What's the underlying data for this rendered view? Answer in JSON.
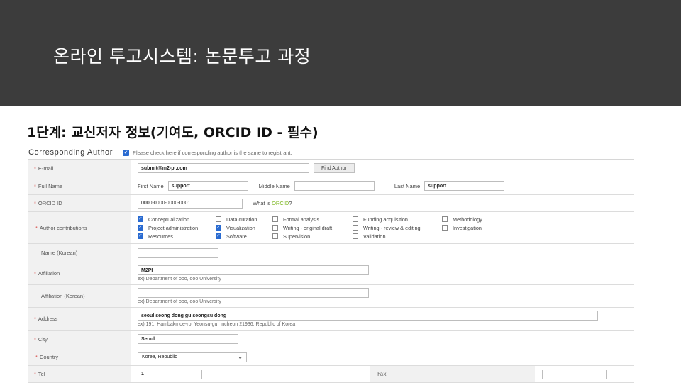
{
  "slide": {
    "title": "온라인 투고시스템: 논문투고 과정"
  },
  "step": {
    "title": "1단계: 교신저자 정보(기여도, ORCID ID - 필수)"
  },
  "corresponding": {
    "label": "Corresponding Author",
    "checked": true,
    "note": "Please check here if corresponding author is the same to registrant."
  },
  "form": {
    "email": {
      "label": "E-mail",
      "value": "submit@m2-pi.com",
      "button": "Find Author"
    },
    "full_name": {
      "label": "Full Name",
      "first_label": "First Name",
      "first_value": "support",
      "middle_label": "Middle Name",
      "middle_value": "",
      "last_label": "Last Name",
      "last_value": "support"
    },
    "orcid": {
      "label": "ORCID ID",
      "value": "0000-0000-0000-0001",
      "what_is": "What is ",
      "link": "ORCID",
      "q": "?"
    },
    "contributions": {
      "label": "Author contributions",
      "items": [
        {
          "text": "Conceptualization",
          "checked": true
        },
        {
          "text": "Data curation",
          "checked": false
        },
        {
          "text": "Formal analysis",
          "checked": false
        },
        {
          "text": "Funding acquisition",
          "checked": false
        },
        {
          "text": "Methodology",
          "checked": false
        },
        {
          "text": "Project administration",
          "checked": true
        },
        {
          "text": "Visualization",
          "checked": true
        },
        {
          "text": "Writing - original draft",
          "checked": false
        },
        {
          "text": "Writing - review & editing",
          "checked": false
        },
        {
          "text": "Investigation",
          "checked": false
        },
        {
          "text": "Resources",
          "checked": true
        },
        {
          "text": "Software",
          "checked": true
        },
        {
          "text": "Supervision",
          "checked": false
        },
        {
          "text": "Validation",
          "checked": false
        }
      ]
    },
    "name_korean": {
      "label": "Name (Korean)",
      "value": ""
    },
    "affiliation": {
      "label": "Affiliation",
      "value": "M2PI",
      "hint": "ex) Department of ooo, ooo University"
    },
    "affiliation_korean": {
      "label": "Affiliation (Korean)",
      "value": "",
      "hint": "ex) Department of ooo, ooo University"
    },
    "address": {
      "label": "Address",
      "value": "seoul seong dong gu seongsu dong",
      "hint": "ex) 191, Hambakmoe-ro, Yeonsu-gu, Incheon 21936, Republic of Korea"
    },
    "city": {
      "label": "City",
      "value": "Seoul"
    },
    "country": {
      "label": "Country",
      "value": "Korea, Republic"
    },
    "tel": {
      "label": "Tel",
      "value": "1",
      "fax_label": "Fax",
      "fax_value": ""
    }
  },
  "colors": {
    "header": "#3c3c3c",
    "required": "#d9534f",
    "checkbox": "#2a6bd1",
    "orcid_link": "#7ab51d"
  }
}
